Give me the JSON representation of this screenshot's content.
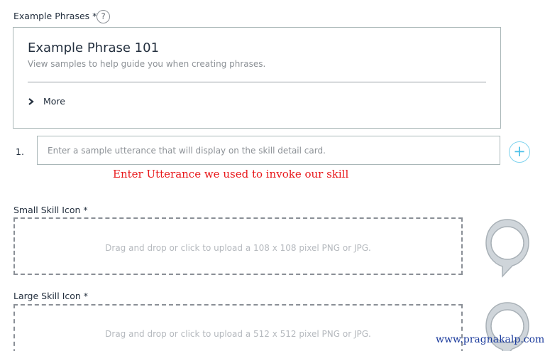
{
  "example_phrases": {
    "label": "Example Phrases *",
    "help_icon": "?",
    "card": {
      "title": "Example Phrase 101",
      "subtitle": "View samples to help guide you when creating phrases.",
      "more_label": "More"
    }
  },
  "utterance": {
    "index": "1.",
    "placeholder": "Enter a sample utterance that will display on the skill detail card.",
    "value": "",
    "add_icon": "+"
  },
  "annotation": "Enter Utterance we used to invoke our skill",
  "small_icon": {
    "label": "Small Skill Icon *",
    "dropzone_text": "Drag and drop or click to upload a 108 x 108 pixel PNG or JPG."
  },
  "large_icon": {
    "label": "Large Skill Icon *",
    "dropzone_text": "Drag and drop or click to upload a 512 x 512 pixel PNG or JPG."
  },
  "watermark": "www.pragnakalp.com",
  "colors": {
    "annotation": "#e8181b",
    "add_button": "#4cc0e8",
    "watermark": "#1a3a9c"
  }
}
